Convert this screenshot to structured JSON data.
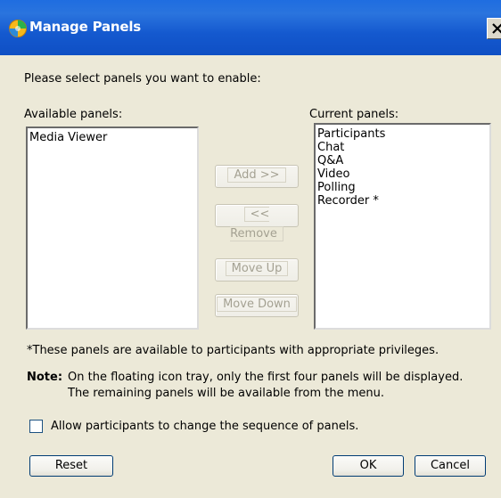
{
  "window": {
    "title": "Manage Panels",
    "icon": "app-globe-icon",
    "close_icon": "close-icon"
  },
  "instruction": "Please select panels you want to enable:",
  "available": {
    "label": "Available panels:",
    "items": [
      "Media Viewer"
    ]
  },
  "current": {
    "label": "Current panels:",
    "items": [
      "Participants",
      "Chat",
      "Q&A",
      "Video",
      "Polling",
      "Recorder *"
    ]
  },
  "buttons": {
    "add": "Add >>",
    "remove": "<< Remove",
    "move_up": "Move Up",
    "move_down": "Move Down",
    "reset": "Reset",
    "ok": "OK",
    "cancel": "Cancel"
  },
  "footnote": "*These panels are available to participants with appropriate privileges.",
  "note": {
    "label": "Note:",
    "line1": "On the floating icon tray, only the first four panels will be displayed.",
    "line2": "The remaining panels will be available from the menu."
  },
  "checkbox": {
    "label": "Allow participants to change the sequence of panels.",
    "checked": false
  },
  "colors": {
    "titlebar": "#1459cf",
    "dialog_bg": "#ece9d8",
    "list_border": "#7f9db9"
  }
}
